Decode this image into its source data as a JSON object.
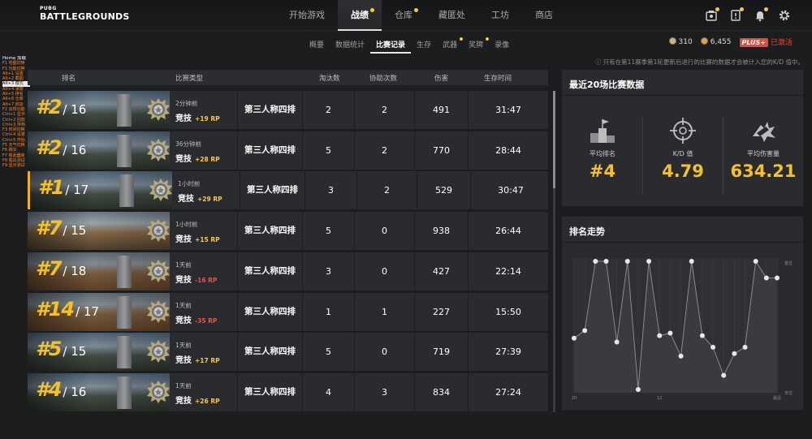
{
  "logo": {
    "line1": "PUBG",
    "line2": "BATTLEGROUNDS"
  },
  "nav": {
    "tabs": [
      {
        "label": "开始游戏",
        "active": false,
        "dot": false
      },
      {
        "label": "战绩",
        "active": true,
        "dot": true
      },
      {
        "label": "仓库",
        "active": false,
        "dot": true
      },
      {
        "label": "藏匿处",
        "active": false,
        "dot": false
      },
      {
        "label": "工坊",
        "active": false,
        "dot": false
      },
      {
        "label": "商店",
        "active": false,
        "dot": false
      }
    ],
    "icons": [
      "inventory-icon",
      "notice-icon",
      "bell-icon",
      "gear-icon"
    ]
  },
  "subnav": {
    "tabs": [
      {
        "label": "概要",
        "active": false,
        "dot": false
      },
      {
        "label": "数据统计",
        "active": false,
        "dot": false
      },
      {
        "label": "比赛记录",
        "active": true,
        "dot": false
      },
      {
        "label": "生存",
        "active": false,
        "dot": false
      },
      {
        "label": "武器",
        "active": false,
        "dot": true
      },
      {
        "label": "奖牌",
        "active": false,
        "dot": true
      },
      {
        "label": "录像",
        "active": false,
        "dot": false
      }
    ]
  },
  "currency": {
    "gcoin": "310",
    "bp": "6,455",
    "plus_badge": "PLUS+",
    "plus_status": "已激活"
  },
  "notice": "ⓘ 只有在第11赛季第1轮更新后进行的比赛的数据才会被计入您的K/D 值中。",
  "debug": {
    "home": "Home 加载",
    "items": [
      "F1 地图切换",
      "F1 功能切换",
      "Alt+1 设置",
      "Alt+2 截图",
      "Alt+3 模式",
      "Alt+4 录像",
      "Alt+5 排名",
      "Alt+6 仓库",
      "Alt+7 商店",
      "F2 出现功能",
      "Ctrl+1 显示",
      "Ctrl+2 回放",
      "Ctrl+3 存档",
      "F3 时间切换",
      "Ctrl+4 设置",
      "Ctrl+5 开始",
      "F5 天气切换",
      "F6 跳伞",
      "F7 新武器库",
      "F8 载具测试",
      "F9 显示测试"
    ]
  },
  "table": {
    "headers": {
      "rank": "排名",
      "type": "比赛类型",
      "kills": "淘汰数",
      "assists": "协助次数",
      "damage": "伤害",
      "survival": "生存时间"
    },
    "rows": [
      {
        "rank": "#2",
        "total": "/ 16",
        "time": "2分钟前",
        "mode_type": "竞技",
        "rp": "+19 RP",
        "rp_sign": "pos",
        "mode": "第三人称四排",
        "kills": "2",
        "assists": "2",
        "damage": "491",
        "survival": "31:47",
        "map": "erangel"
      },
      {
        "rank": "#2",
        "total": "/ 16",
        "time": "36分钟前",
        "mode_type": "竞技",
        "rp": "+28 RP",
        "rp_sign": "pos",
        "mode": "第三人称四排",
        "kills": "5",
        "assists": "2",
        "damage": "770",
        "survival": "28:44",
        "map": "erangel"
      },
      {
        "rank": "#1",
        "total": "/ 17",
        "time": "1小时前",
        "mode_type": "竞技",
        "rp": "+29 RP",
        "rp_sign": "pos",
        "mode": "第三人称四排",
        "kills": "3",
        "assists": "2",
        "damage": "529",
        "survival": "30:47",
        "map": "erangel"
      },
      {
        "rank": "#7",
        "total": "/ 15",
        "time": "1小时前",
        "mode_type": "竞技",
        "rp": "+15 RP",
        "rp_sign": "pos",
        "mode": "第三人称四排",
        "kills": "5",
        "assists": "0",
        "damage": "938",
        "survival": "26:44",
        "map": "village"
      },
      {
        "rank": "#7",
        "total": "/ 18",
        "time": "1天前",
        "mode_type": "竞技",
        "rp": "-16 RP",
        "rp_sign": "neg",
        "mode": "第三人称四排",
        "kills": "3",
        "assists": "0",
        "damage": "427",
        "survival": "22:14",
        "map": "desert"
      },
      {
        "rank": "#14",
        "total": "/ 17",
        "time": "1天前",
        "mode_type": "竞技",
        "rp": "-35 RP",
        "rp_sign": "neg",
        "mode": "第三人称四排",
        "kills": "1",
        "assists": "1",
        "damage": "227",
        "survival": "15:50",
        "map": "desert"
      },
      {
        "rank": "#5",
        "total": "/ 15",
        "time": "1天前",
        "mode_type": "竞技",
        "rp": "+17 RP",
        "rp_sign": "pos",
        "mode": "第三人称四排",
        "kills": "5",
        "assists": "0",
        "damage": "719",
        "survival": "27:39",
        "map": "erangel"
      },
      {
        "rank": "#4",
        "total": "/ 16",
        "time": "1天前",
        "mode_type": "竞技",
        "rp": "+26 RP",
        "rp_sign": "pos",
        "mode": "第三人称四排",
        "kills": "4",
        "assists": "3",
        "damage": "834",
        "survival": "27:24",
        "map": "erangel"
      }
    ]
  },
  "summary": {
    "title": "最近20场比赛数据",
    "stats": [
      {
        "icon": "podium-icon",
        "label": "平均排名",
        "value": "#4"
      },
      {
        "icon": "crosshair-icon",
        "label": "K/D 值",
        "value": "4.79"
      },
      {
        "icon": "bullet-impact-icon",
        "label": "平均伤害量",
        "value": "634.21"
      }
    ]
  },
  "trend": {
    "title": "排名走势"
  },
  "chart_data": {
    "type": "line",
    "title": "排名走势",
    "y_top_label": "首位",
    "y_bottom_label": "末位",
    "x_ticks": [
      "20",
      "12",
      "最近"
    ],
    "x": [
      20,
      19,
      18,
      17,
      16,
      15,
      14,
      13,
      12,
      11,
      10,
      9,
      8,
      7,
      6,
      5,
      4,
      3,
      2,
      1
    ],
    "y_rank_level": [
      0.4,
      0.46,
      1.0,
      1.0,
      0.37,
      1.0,
      0.0,
      1.0,
      0.42,
      0.44,
      0.26,
      1.0,
      0.42,
      0.33,
      0.11,
      0.28,
      0.33,
      1.0,
      0.87,
      0.87
    ],
    "ylim": [
      0,
      1
    ],
    "colors": {
      "line": "#8a8a8a",
      "point": "#e8e8e8",
      "fill": "#3a3b3e"
    }
  },
  "colors": {
    "accent": "#f5c125",
    "negative": "#e5534b",
    "plus": "#e5493a"
  }
}
